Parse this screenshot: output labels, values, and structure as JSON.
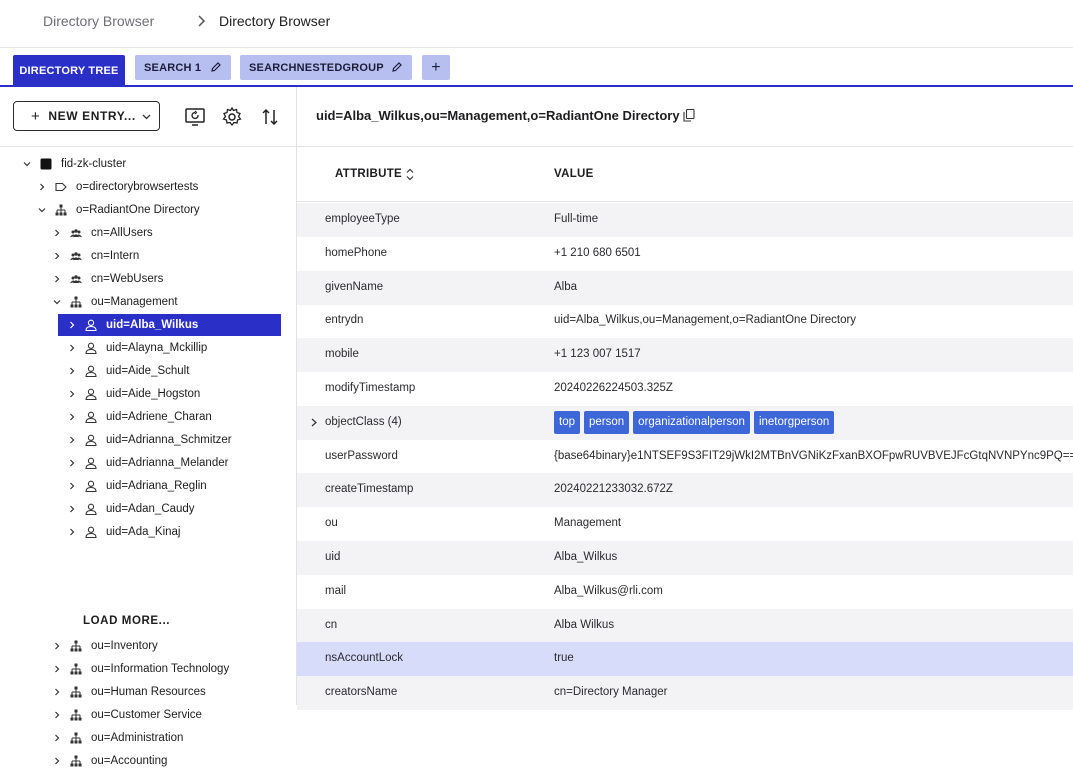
{
  "breadcrumb": {
    "root": "Directory Browser",
    "current": "Directory Browser"
  },
  "tabs": {
    "directory_tree": "DIRECTORY TREE",
    "search1": "SEARCH 1",
    "searchnested": "SEARCHNESTEDGROUP",
    "add": "+"
  },
  "toolbar": {
    "new_entry": "NEW ENTRY..."
  },
  "tree": {
    "root": "fid-zk-cluster",
    "o_tests": "o=directorybrowsertests",
    "o_radiant": "o=RadiantOne Directory",
    "cn_allusers": "cn=AllUsers",
    "cn_intern": "cn=Intern",
    "cn_webusers": "cn=WebUsers",
    "ou_management": "ou=Management",
    "users": [
      "uid=Alba_Wilkus",
      "uid=Alayna_Mckillip",
      "uid=Aide_Schult",
      "uid=Aide_Hogston",
      "uid=Adriene_Charan",
      "uid=Adrianna_Schmitzer",
      "uid=Adrianna_Melander",
      "uid=Adriana_Reglin",
      "uid=Adan_Caudy",
      "uid=Ada_Kinaj"
    ],
    "load_more": "LOAD MORE...",
    "ous": [
      "ou=Inventory",
      "ou=Information Technology",
      "ou=Human Resources",
      "ou=Customer Service",
      "ou=Administration",
      "ou=Accounting"
    ]
  },
  "detail": {
    "dn": "uid=Alba_Wilkus,ou=Management,o=RadiantOne Directory",
    "headers": {
      "attribute": "ATTRIBUTE",
      "value": "VALUE"
    },
    "rows": [
      {
        "attr": "employeeType",
        "value": "Full-time"
      },
      {
        "attr": "homePhone",
        "value": "+1 210 680 6501"
      },
      {
        "attr": "givenName",
        "value": "Alba"
      },
      {
        "attr": "entrydn",
        "value": "uid=Alba_Wilkus,ou=Management,o=RadiantOne Directory"
      },
      {
        "attr": "mobile",
        "value": "+1 123 007 1517"
      },
      {
        "attr": "modifyTimestamp",
        "value": "20240226224503.325Z"
      },
      {
        "attr": "objectClass (4)",
        "value": ""
      },
      {
        "attr": "userPassword",
        "value": "{base64binary}e1NTSEF9S3FIT29jWkI2MTBnVGNiKzFxanBXOFpwRUVBVEJFcGtqNVNPYnc9PQ=="
      },
      {
        "attr": "createTimestamp",
        "value": "20240221233032.672Z"
      },
      {
        "attr": "ou",
        "value": "Management"
      },
      {
        "attr": "uid",
        "value": "Alba_Wilkus"
      },
      {
        "attr": "mail",
        "value": "Alba_Wilkus@rli.com"
      },
      {
        "attr": "cn",
        "value": "Alba Wilkus"
      },
      {
        "attr": "nsAccountLock",
        "value": "true"
      },
      {
        "attr": "creatorsName",
        "value": "cn=Directory Manager"
      }
    ],
    "object_classes": [
      "top",
      "person",
      "organizationalperson",
      "inetorgperson"
    ]
  },
  "colors": {
    "accent": "#2a2fc7",
    "tab_inactive": "#b7bff0",
    "chip": "#3d66d9",
    "row_highlight": "#d7dcfb"
  }
}
